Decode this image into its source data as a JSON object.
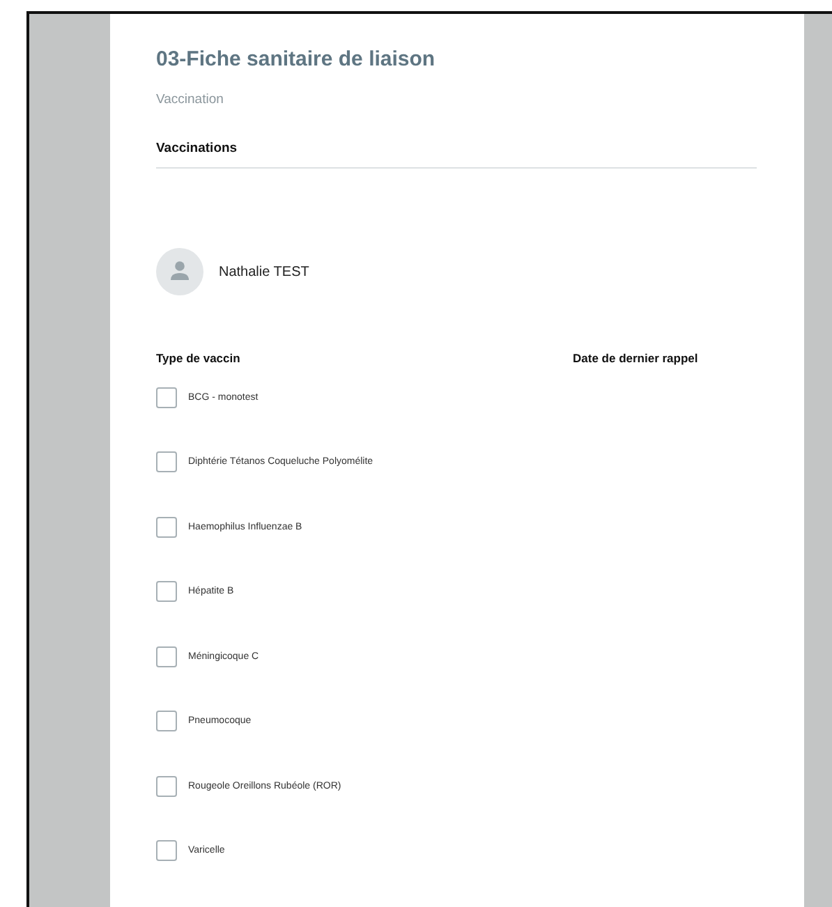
{
  "form": {
    "title": "03-Fiche sanitaire de liaison",
    "subtitle": "Vaccination",
    "section": "Vaccinations"
  },
  "person": {
    "name": "Nathalie TEST"
  },
  "columns": [
    "Type de vaccin",
    "Date de dernier rappel"
  ],
  "vaccines": [
    {
      "label": "BCG - monotest",
      "checked": false
    },
    {
      "label": "Diphtérie Tétanos Coqueluche Polyomélite",
      "checked": false
    },
    {
      "label": "Haemophilus Influenzae B",
      "checked": false
    },
    {
      "label": "Hépatite B",
      "checked": false
    },
    {
      "label": "Méningicoque C",
      "checked": false
    },
    {
      "label": "Pneumocoque",
      "checked": false
    },
    {
      "label": "Rougeole Oreillons Rubéole (ROR)",
      "checked": false
    },
    {
      "label": "Varicelle",
      "checked": false
    }
  ]
}
